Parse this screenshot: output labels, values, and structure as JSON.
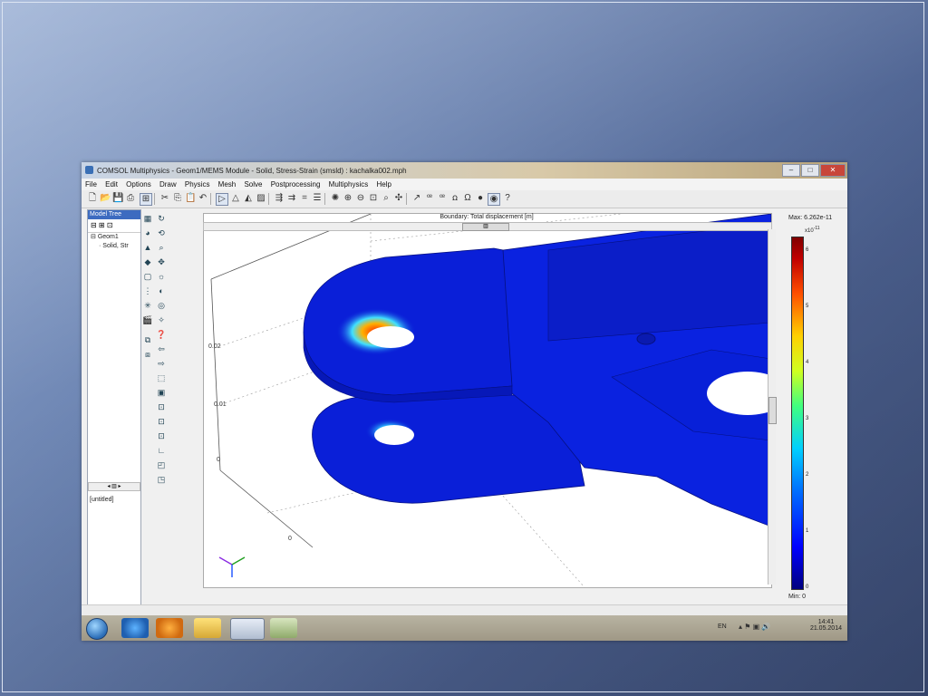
{
  "window": {
    "title": "COMSOL Multiphysics - Geom1/MEMS Module - Solid, Stress-Strain (smsld) : kachalka002.mph",
    "buttons": {
      "minimize": "–",
      "maximize": "□",
      "close": "✕"
    }
  },
  "menu": [
    "File",
    "Edit",
    "Options",
    "Draw",
    "Physics",
    "Mesh",
    "Solve",
    "Postprocessing",
    "Multiphysics",
    "Help"
  ],
  "model_tree": {
    "header": "Model Tree",
    "tools": "⊟ ⊞ ⊡",
    "items": [
      "Geom1",
      "Solid, Str"
    ],
    "scroll": "◂ ▥ ▸",
    "untitled": "[untitled]"
  },
  "plot": {
    "title": "Boundary: Total displacement [m]",
    "scroll_thumb": "▥",
    "axis_ticks": [
      "0.02",
      "0.01",
      "0",
      "0"
    ],
    "axis_triad": "y x z"
  },
  "colorbar": {
    "max_label": "Max: 6.262e-11",
    "exponent": "x10",
    "exponent_power": "-11",
    "ticks": [
      "6",
      "5",
      "4",
      "3",
      "2",
      "1",
      "0"
    ],
    "min_label": "Min: 0"
  },
  "taskbar": {
    "lang": "EN",
    "time": "14:41",
    "date": "21.05.2014"
  },
  "colors": {
    "accent": "#3d6bc0",
    "mesh_blue": "#0a1fd8"
  }
}
